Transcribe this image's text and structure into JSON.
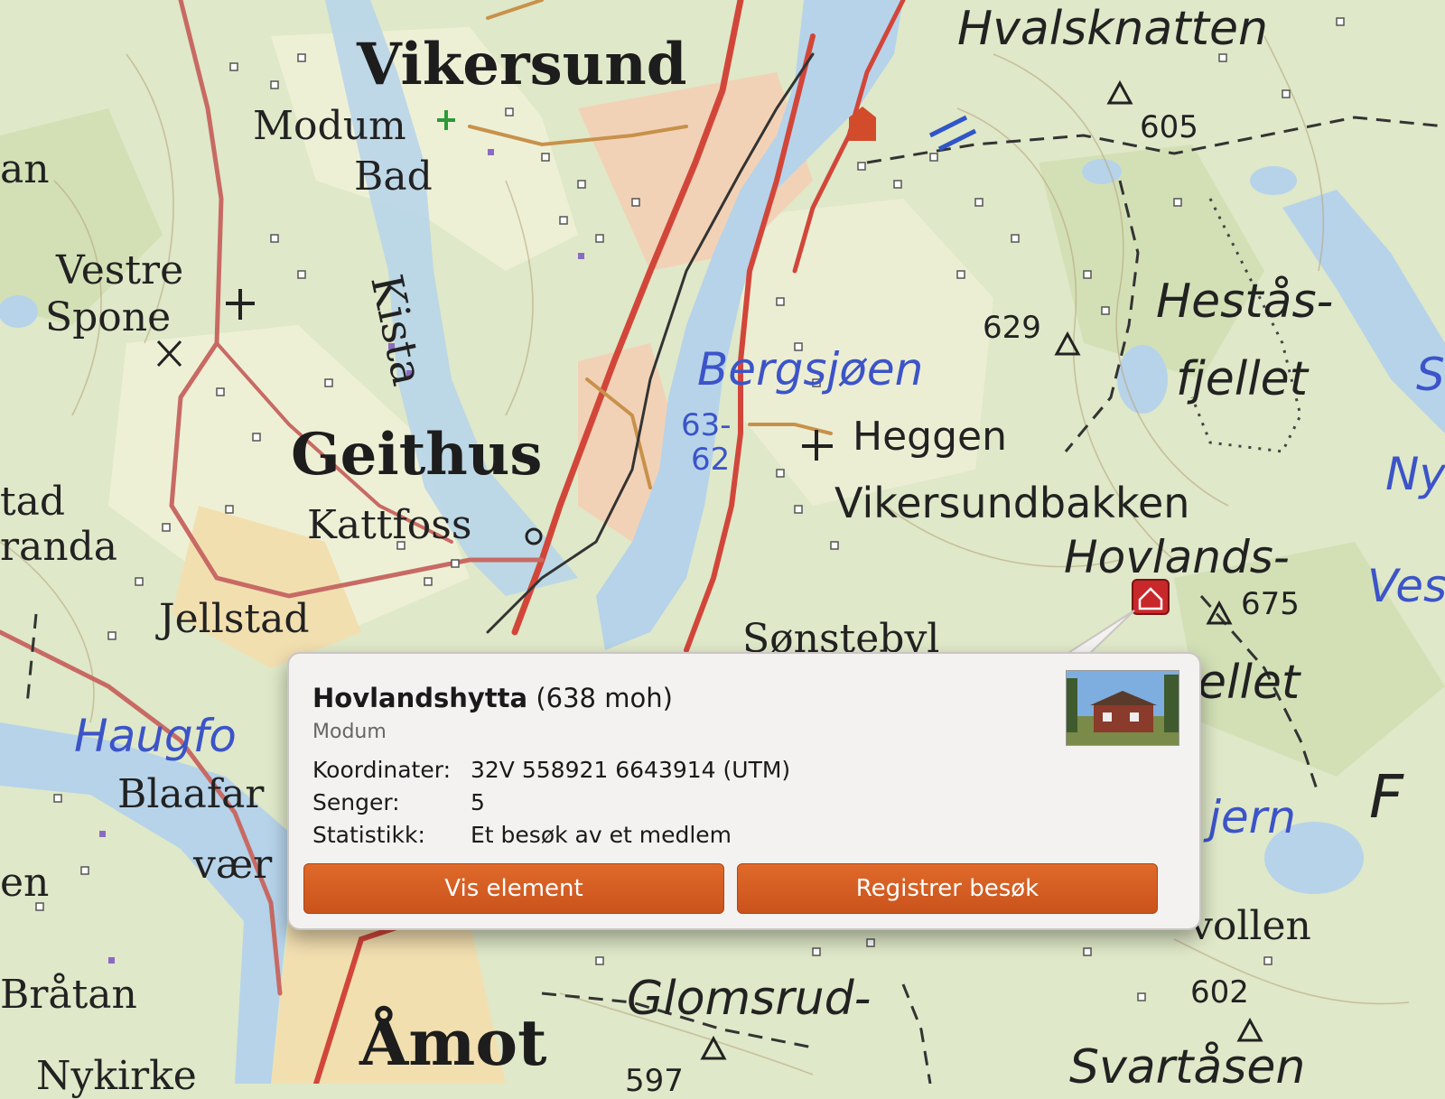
{
  "map": {
    "labels": {
      "hvalsknatten": "Hvalsknatten",
      "vikersund": "Vikersund",
      "modum_bad_1": "Modum",
      "modum_bad_2": "Bad",
      "an": "an",
      "vestre_spone_1": "Vestre",
      "vestre_spone_2": "Spone",
      "kista": "Kista",
      "bergsjoen": "Bergsjøen",
      "lake_num_1": "63-",
      "lake_num_2": "62",
      "heggen": "Heggen",
      "vikersundbakken": "Vikersundbakken",
      "hestas_1": "Hestås-",
      "hestas_2": "fjellet",
      "hovlands": "Hovlands-",
      "geithus": "Geithus",
      "kattfoss": "Kattfoss",
      "jellstad": "Jellstad",
      "tad": "tad",
      "randa": "randa",
      "haugfo": "Haugfo",
      "blaafar": "Blaafar",
      "vaer": "vær",
      "en": "en",
      "bratan": "Bråtan",
      "amot": "Åmot",
      "glomsrud": "Glomsrud-",
      "vollen": "vollen",
      "svartasen": "Svartåsen",
      "sonstebyl": "Sønstebyl",
      "fjellet_right": "ellet",
      "tjern": "jern",
      "F": "F",
      "ny": "Ny",
      "ves": "Ves",
      "s": "S",
      "nykirke": "Nykirke",
      "h605": "605",
      "h629": "629",
      "h675": "675",
      "h602": "602",
      "h597": "597"
    }
  },
  "popup": {
    "title": "Hovlandshytta",
    "elevation": "(638 moh)",
    "municipality": "Modum",
    "rows": [
      {
        "key": "Koordinater:",
        "value": "32V 558921 6643914 (UTM)"
      },
      {
        "key": "Senger:",
        "value": "5"
      },
      {
        "key": "Statistikk:",
        "value": "Et besøk av et medlem"
      }
    ],
    "buttons": {
      "view": "Vis element",
      "register": "Registrer besøk"
    }
  },
  "colors": {
    "button_orange": "#d35e22",
    "road_red": "#d2463a",
    "water_blue": "#b6d3ea",
    "forest_green": "#dfe8c8",
    "built_up": "#f2dfb0",
    "cabin_marker": "#c8282a"
  }
}
